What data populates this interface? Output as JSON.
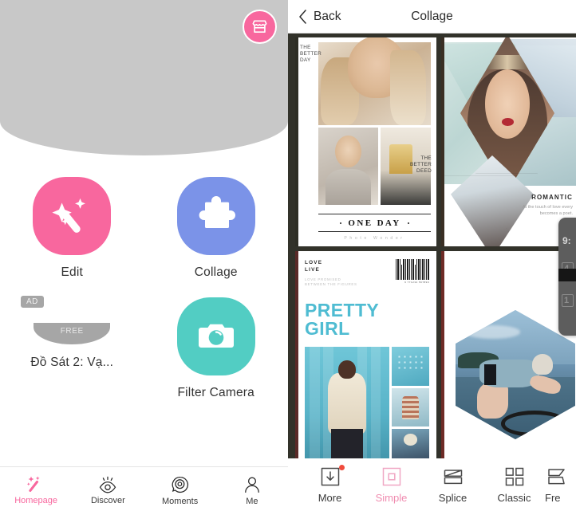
{
  "left_app": {
    "shop_icon": "storefront-icon",
    "apps": [
      {
        "label": "Edit",
        "icon": "magic-wand-icon",
        "color": "#f8679e"
      },
      {
        "label": "Collage",
        "icon": "puzzle-piece-icon",
        "color": "#7b93e8"
      },
      {
        "label": "Filter Camera",
        "icon": "camera-icon",
        "color": "#52cdc3"
      }
    ],
    "ad": {
      "badge": "AD",
      "free_label": "FREE",
      "title": "Đồ Sát 2: Vạ..."
    },
    "tabbar": [
      {
        "label": "Homepage",
        "icon": "magic-wand-icon",
        "active": true
      },
      {
        "label": "Discover",
        "icon": "eye-icon",
        "active": false
      },
      {
        "label": "Moments",
        "icon": "moments-icon",
        "active": false
      },
      {
        "label": "Me",
        "icon": "person-icon",
        "active": false
      }
    ],
    "accent_color": "#f8679e"
  },
  "collage_screen": {
    "back_label": "Back",
    "back_icon": "chevron-left-icon",
    "title": "Collage",
    "templates": [
      {
        "name": "one-day",
        "caption_top": "THE\nBETTER\nDAY",
        "caption_mid": "THE\nBETTER\nDEED",
        "title": "ONE DAY",
        "subtitle": "Photo  Wonder"
      },
      {
        "name": "romantic",
        "title": "ROMANTIC",
        "body": "At the touch of love every\nbecomes a poet."
      },
      {
        "name": "pretty-girl",
        "brand": "LOVE\nLIVE",
        "tagline": "LOVE  PROMISED\nBETWEEN THE FIGURES",
        "barcode_text": "9 771234 567890",
        "title": "PRETTY GIRL",
        "title_color": "#4fbcd2"
      },
      {
        "name": "hexagon",
        "title": ""
      }
    ],
    "toolbar": [
      {
        "label": "More",
        "icon": "download-box-icon",
        "active": false,
        "badge": true
      },
      {
        "label": "Simple",
        "icon": "single-frame-icon",
        "active": true,
        "badge": false
      },
      {
        "label": "Splice",
        "icon": "splice-frame-icon",
        "active": false,
        "badge": false
      },
      {
        "label": "Classic",
        "icon": "grid-frame-icon",
        "active": false,
        "badge": false
      },
      {
        "label": "Fre",
        "icon": "free-frame-icon",
        "active": false,
        "badge": false
      }
    ],
    "active_color": "#f08cb0",
    "badge_color": "#f04b3c"
  },
  "side_widget": {
    "visible_text": "9:"
  }
}
